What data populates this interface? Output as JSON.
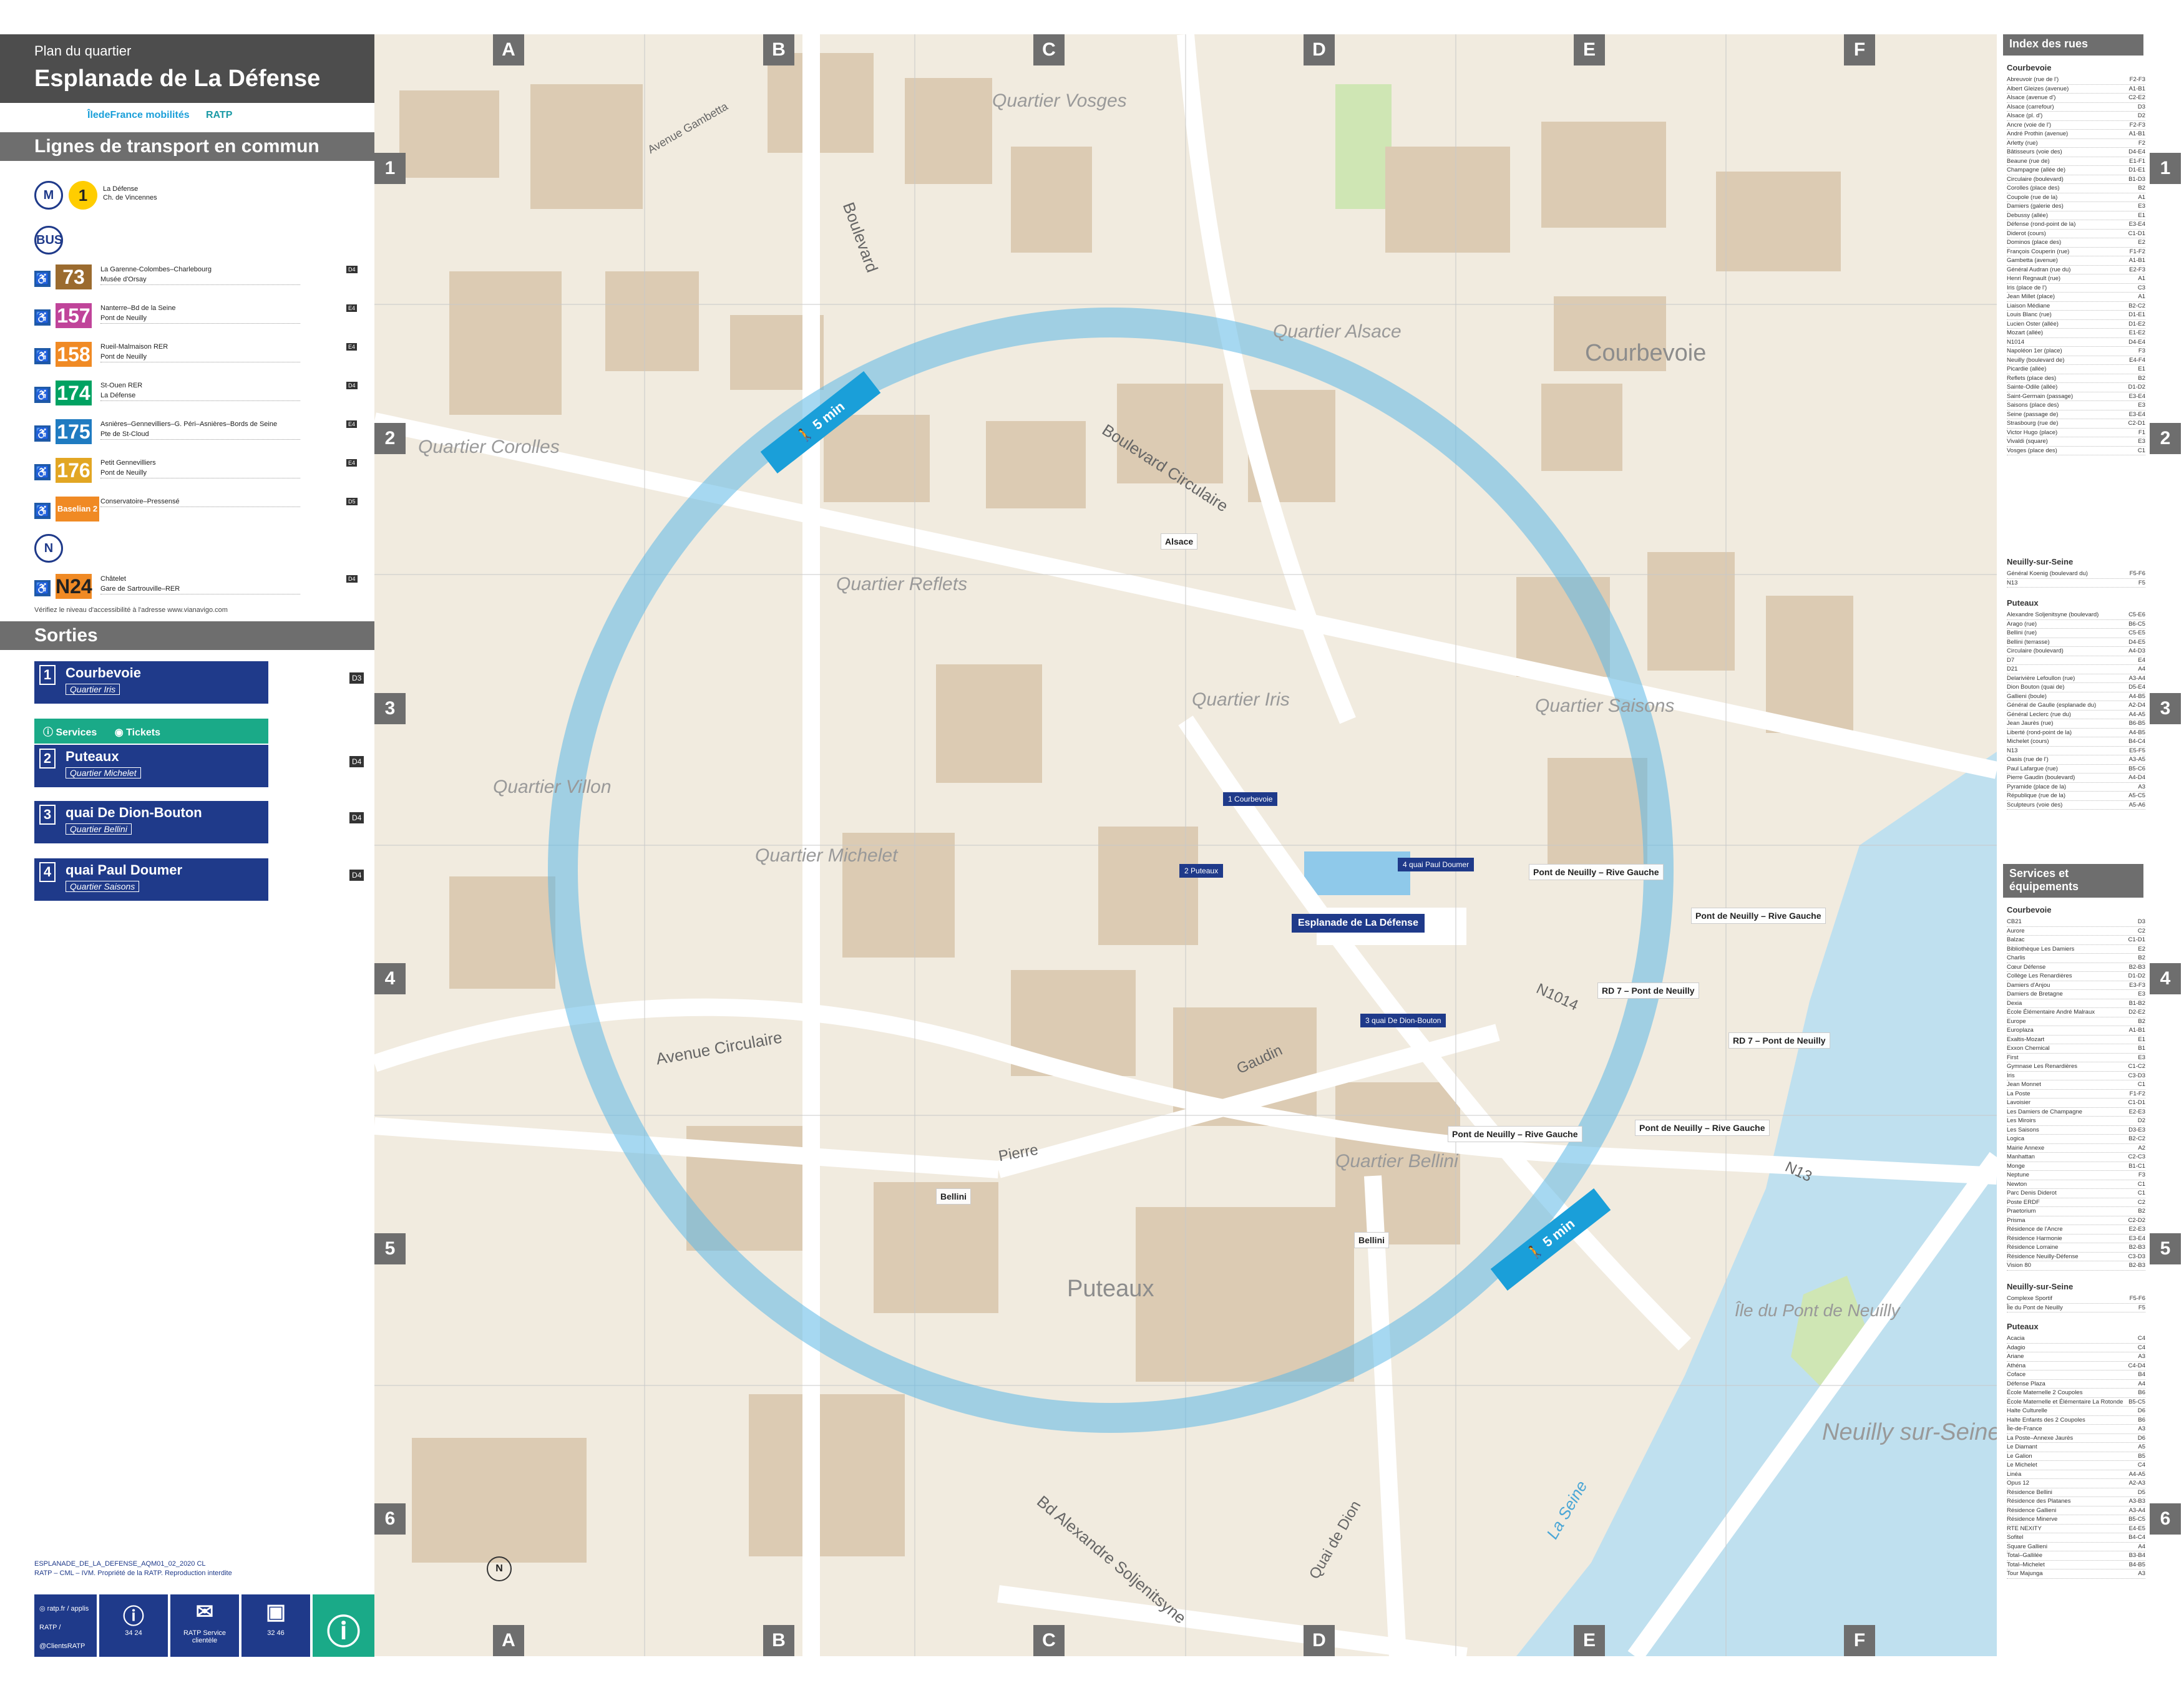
{
  "header": {
    "plan_label": "Plan du quartier",
    "title": "Esplanade de La Défense"
  },
  "logos": {
    "idf": "ÎledeFrance mobilités",
    "ratp": "RATP"
  },
  "transport": {
    "heading": "Lignes de transport en commun",
    "metro": {
      "line": "1",
      "text": "La Défense\nCh. de Vincennes",
      "color": "#ffcd00"
    },
    "bus_lines": [
      {
        "number": "73",
        "text": "La Garenne-Colombes–Charlebourg\nMusée d'Orsay",
        "color": "#9b6b2f",
        "ref": "D4"
      },
      {
        "number": "157",
        "text": "Nanterre–Bd de la Seine\nPont de Neuilly",
        "color": "#c0449a",
        "ref": "E4"
      },
      {
        "number": "158",
        "text": "Rueil-Malmaison RER\nPont de Neuilly",
        "color": "#f08a24",
        "ref": "E4"
      },
      {
        "number": "174",
        "text": "St-Ouen RER\nLa Défense",
        "color": "#00a262",
        "ref": "D4"
      },
      {
        "number": "175",
        "text": "Asnières–Gennevilliers–G. Péri–Asnières–Bords de Seine\nPte de St-Cloud",
        "color": "#1f7bc1",
        "ref": "E4"
      },
      {
        "number": "176",
        "text": "Petit Gennevilliers\nPont de Neuilly",
        "color": "#e2a623",
        "ref": "E4"
      },
      {
        "number": "Baselian 2",
        "text": "Conservatoire–Pressensé",
        "color": "#f08a24",
        "ref": "D5"
      }
    ],
    "noctilien": {
      "number": "N24",
      "text": "Châtelet\nGare de Sartrouville–RER",
      "color": "#f08a24",
      "ref": "D4"
    },
    "accessibility_note": "Vérifiez le niveau d'accessibilité à l'adresse www.vianavigo.com"
  },
  "exits": {
    "heading": "Sorties",
    "items": [
      {
        "num": "1",
        "name": "Courbevoie",
        "sub": "Quartier Iris",
        "ref": "D3"
      },
      {
        "num": "2",
        "name": "Puteaux",
        "sub": "Quartier Michelet",
        "ref": "D4"
      },
      {
        "num": "3",
        "name": "quai De Dion-Bouton",
        "sub": "Quartier Bellini",
        "ref": "D4"
      },
      {
        "num": "4",
        "name": "quai Paul Doumer",
        "sub": "Quartier Saisons",
        "ref": "D4"
      }
    ],
    "services": "Services",
    "tickets": "Tickets"
  },
  "footer": {
    "ref": "ESPLANADE_DE_LA_DEFENSE_AQM01_02_2020 CL\nRATP – CML – IVM. Propriété de la RATP. Reproduction interdite",
    "cells": [
      {
        "icon": "globe-icon",
        "text": "ratp.fr / applis RATP / @ClientsRATP"
      },
      {
        "icon": "info-icon",
        "text": "34 24"
      },
      {
        "icon": "mail-icon",
        "text": "RATP Service clientèle"
      },
      {
        "icon": "luggage-icon",
        "text": "32 46"
      }
    ]
  },
  "map": {
    "columns": [
      "A",
      "B",
      "C",
      "D",
      "E",
      "F"
    ],
    "rows": [
      "1",
      "2",
      "3",
      "4",
      "5",
      "6"
    ],
    "districts": [
      {
        "name": "Quartier Vosges"
      },
      {
        "name": "Quartier Alsace"
      },
      {
        "name": "Courbevoie"
      },
      {
        "name": "Quartier Corolles"
      },
      {
        "name": "Quartier Reflets"
      },
      {
        "name": "Quartier Iris"
      },
      {
        "name": "Quartier Saisons"
      },
      {
        "name": "Quartier Villon"
      },
      {
        "name": "Quartier Michelet"
      },
      {
        "name": "Quartier Bellini"
      },
      {
        "name": "Puteaux"
      },
      {
        "name": "Île du Pont de Neuilly"
      },
      {
        "name": "Neuilly sur-Seine"
      }
    ],
    "streets": [
      "Boulevard Circulaire",
      "Avenue Gambetta",
      "Boulevard",
      "Avenue Circulaire",
      "Pierre",
      "Gaudin",
      "Bd Alexandre Soljenitsyne",
      "Quai de Dion",
      "N1014",
      "N13",
      "La Seine"
    ],
    "walk_badge": "5 min",
    "station": "Esplanade de La Défense",
    "stop_names": [
      "Alsace",
      "Bellini",
      "Pont de Neuilly – Rive Gauche",
      "RD 7 – Pont de Neuilly"
    ]
  },
  "index": {
    "heading": "Index des rues",
    "courbevoie_head": "Courbevoie",
    "courbevoie": [
      [
        "Abreuvoir (rue de l')",
        "F2-F3"
      ],
      [
        "Albert Gleizes (avenue)",
        "A1-B1"
      ],
      [
        "Alsace (avenue d')",
        "C2-E2"
      ],
      [
        "Alsace (carrefour)",
        "D3"
      ],
      [
        "Alsace (pl. d')",
        "D2"
      ],
      [
        "Ancre (voie de l')",
        "F2-F3"
      ],
      [
        "André Prothin (avenue)",
        "A1-B1"
      ],
      [
        "Arletty (rue)",
        "F2"
      ],
      [
        "Bâtisseurs (voie des)",
        "D4-E4"
      ],
      [
        "Beaune (rue de)",
        "E1-F1"
      ],
      [
        "Champagne (allée de)",
        "D1-E1"
      ],
      [
        "Circulaire (boulevard)",
        "B1-D3"
      ],
      [
        "Corolles (place des)",
        "B2"
      ],
      [
        "Coupole (rue de la)",
        "A1"
      ],
      [
        "Damiers (galerie des)",
        "E3"
      ],
      [
        "Debussy (allée)",
        "E1"
      ],
      [
        "Défense (rond-point de la)",
        "E3-E4"
      ],
      [
        "Diderot (cours)",
        "C1-D1"
      ],
      [
        "Dominos (place des)",
        "E2"
      ],
      [
        "François Couperin (rue)",
        "F1-F2"
      ],
      [
        "Gambetta (avenue)",
        "A1-B1"
      ],
      [
        "Général Audran (rue du)",
        "E2-F3"
      ],
      [
        "Henri Regnault (rue)",
        "A1"
      ],
      [
        "Iris (place de l')",
        "C3"
      ],
      [
        "Jean Millet (place)",
        "A1"
      ],
      [
        "Liaison Médiane",
        "B2-C2"
      ],
      [
        "Louis Blanc (rue)",
        "D1-E1"
      ],
      [
        "Lucien Oster (allée)",
        "D1-E2"
      ],
      [
        "Mozart (allée)",
        "E1-E2"
      ],
      [
        "N1014",
        "D4-E4"
      ],
      [
        "Napoléon 1er (place)",
        "F3"
      ],
      [
        "Neuilly (boulevard de)",
        "E4-F4"
      ],
      [
        "Picardie (allée)",
        "E1"
      ],
      [
        "Reflets (place des)",
        "B2"
      ],
      [
        "Sainte-Odile (allée)",
        "D1-D2"
      ],
      [
        "Saint-Germain (passage)",
        "E3-E4"
      ],
      [
        "Saisons (place des)",
        "E3"
      ],
      [
        "Seine (passage de)",
        "E3-E4"
      ],
      [
        "Strasbourg (rue de)",
        "C2-D1"
      ],
      [
        "Victor Hugo (place)",
        "F1"
      ],
      [
        "Vivaldi (square)",
        "E3"
      ],
      [
        "Vosges (place des)",
        "C1"
      ]
    ],
    "neuilly_head": "Neuilly-sur-Seine",
    "neuilly": [
      [
        "Général Koenig (boulevard du)",
        "F5-F6"
      ],
      [
        "N13",
        "F5"
      ]
    ],
    "puteaux_head": "Puteaux",
    "puteaux": [
      [
        "Alexandre Soljenitsyne (boulevard)",
        "C5-E6"
      ],
      [
        "Arago (rue)",
        "B6-C5"
      ],
      [
        "Bellini (rue)",
        "C5-E5"
      ],
      [
        "Bellini (terrasse)",
        "D4-E5"
      ],
      [
        "Circulaire (boulevard)",
        "A4-D3"
      ],
      [
        "D7",
        "E4"
      ],
      [
        "D21",
        "A4"
      ],
      [
        "Delarivière Lefoullon (rue)",
        "A3-A4"
      ],
      [
        "Dion Bouton (quai de)",
        "D5-E4"
      ],
      [
        "Gallieni (boule)",
        "A4-B5"
      ],
      [
        "Général de Gaulle (esplanade du)",
        "A2-D4"
      ],
      [
        "Général Leclerc (rue du)",
        "A4-A5"
      ],
      [
        "Jean Jaurès (rue)",
        "B6-B5"
      ],
      [
        "Liberté (rond-point de la)",
        "A4-B5"
      ],
      [
        "Michelet (cours)",
        "B4-C4"
      ],
      [
        "N13",
        "E5-F5"
      ],
      [
        "Oasis (rue de l')",
        "A3-A5"
      ],
      [
        "Paul Lafargue (rue)",
        "B5-C6"
      ],
      [
        "Pierre Gaudin (boulevard)",
        "A4-D4"
      ],
      [
        "Pyramide (place de la)",
        "A3"
      ],
      [
        "République (rue de la)",
        "A5-C5"
      ],
      [
        "Sculpteurs (voie des)",
        "A5-A6"
      ]
    ],
    "services_head": "Services et équipements",
    "services_courbevoie_head": "Courbevoie",
    "services_courbevoie": [
      [
        "CB21",
        "D3"
      ],
      [
        "Aurore",
        "C2"
      ],
      [
        "Balzac",
        "C1-D1"
      ],
      [
        "Bibliothèque Les Damiers",
        "E2"
      ],
      [
        "Charlis",
        "B2"
      ],
      [
        "Cœur Défense",
        "B2-B3"
      ],
      [
        "Collège Les Renardières",
        "D1-D2"
      ],
      [
        "Damiers d'Anjou",
        "E3-F3"
      ],
      [
        "Damiers de Bretagne",
        "E3"
      ],
      [
        "Dexia",
        "B1-B2"
      ],
      [
        "École Élémentaire André Malraux",
        "D2-E2"
      ],
      [
        "Europe",
        "B2"
      ],
      [
        "Europlaza",
        "A1-B1"
      ],
      [
        "Exaltis-Mozart",
        "E1"
      ],
      [
        "Exxon Chemical",
        "B1"
      ],
      [
        "First",
        "E3"
      ],
      [
        "Gymnase Les Renardières",
        "C1-C2"
      ],
      [
        "Iris",
        "C3-D3"
      ],
      [
        "Jean Monnet",
        "C1"
      ],
      [
        "La Poste",
        "F1-F2"
      ],
      [
        "Lavoisier",
        "C1-D1"
      ],
      [
        "Les Damiers de Champagne",
        "E2-E3"
      ],
      [
        "Les Miroirs",
        "D2"
      ],
      [
        "Les Saisons",
        "D3-E3"
      ],
      [
        "Logica",
        "B2-C2"
      ],
      [
        "Mairie Annexe",
        "A2"
      ],
      [
        "Manhattan",
        "C2-C3"
      ],
      [
        "Monge",
        "B1-C1"
      ],
      [
        "Neptune",
        "F3"
      ],
      [
        "Newton",
        "C1"
      ],
      [
        "Parc Denis Diderot",
        "C1"
      ],
      [
        "Poste ERDF",
        "C2"
      ],
      [
        "Praetorium",
        "B2"
      ],
      [
        "Prisma",
        "C2-D2"
      ],
      [
        "Résidence de l'Ancre",
        "E2-E3"
      ],
      [
        "Résidence Harmonie",
        "E3-E4"
      ],
      [
        "Résidence Lorraine",
        "B2-B3"
      ],
      [
        "Résidence Neuilly-Défense",
        "C3-D3"
      ],
      [
        "Vision 80",
        "B2-B3"
      ]
    ],
    "services_neuilly_head": "Neuilly-sur-Seine",
    "services_neuilly": [
      [
        "Complexe Sportif",
        "F5-F6"
      ],
      [
        "Île du Pont de Neuilly",
        "F5"
      ]
    ],
    "services_puteaux_head": "Puteaux",
    "services_puteaux": [
      [
        "Acacia",
        "C4"
      ],
      [
        "Adagio",
        "C4"
      ],
      [
        "Ariane",
        "A3"
      ],
      [
        "Athéna",
        "C4-D4"
      ],
      [
        "Coface",
        "B4"
      ],
      [
        "Défense Plaza",
        "A4"
      ],
      [
        "École Maternelle 2 Coupoles",
        "B6"
      ],
      [
        "École Maternelle et Élémentaire La Rotonde",
        "B5-C5"
      ],
      [
        "Halte Culturelle",
        "D6"
      ],
      [
        "Halte Enfants des 2 Coupoles",
        "B6"
      ],
      [
        "Île-de-France",
        "A3"
      ],
      [
        "La Poste–Annexe Jaurès",
        "D6"
      ],
      [
        "Le Diamant",
        "A5"
      ],
      [
        "Le Galion",
        "B5"
      ],
      [
        "Le Michelet",
        "C4"
      ],
      [
        "Linéa",
        "A4-A5"
      ],
      [
        "Opus 12",
        "A2-A3"
      ],
      [
        "Résidence Bellini",
        "D5"
      ],
      [
        "Résidence des Platanes",
        "A3-B3"
      ],
      [
        "Résidence Gallieni",
        "A3-A4"
      ],
      [
        "Résidence Minerve",
        "B5-C5"
      ],
      [
        "RTE NEXITY",
        "E4-E5"
      ],
      [
        "Sofitel",
        "B4-C4"
      ],
      [
        "Square Gallieni",
        "A4"
      ],
      [
        "Total–Gallilée",
        "B3-B4"
      ],
      [
        "Total–Michelet",
        "B4-B5"
      ],
      [
        "Tour Majunga",
        "A3"
      ]
    ]
  }
}
